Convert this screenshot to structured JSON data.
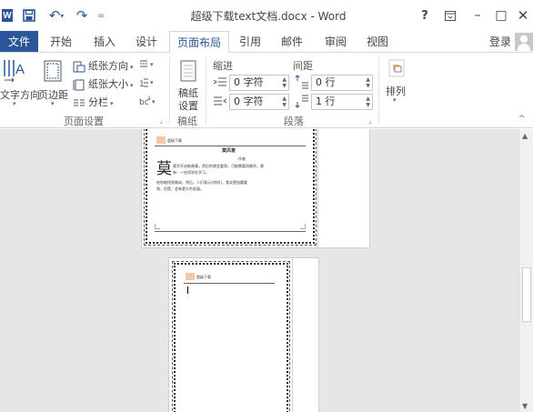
{
  "window": {
    "title": "超级下载text文档.docx - Word",
    "help": "?",
    "ribbon_options_icon": "ribbon-display-options-icon",
    "minimize": "–",
    "maximize": "□",
    "close": "✕"
  },
  "qat": {
    "app_icon_letter": "W",
    "undo": "↶",
    "redo": "↷",
    "more": "="
  },
  "tabs": [
    {
      "label": "文件"
    },
    {
      "label": "开始"
    },
    {
      "label": "插入"
    },
    {
      "label": "设计"
    },
    {
      "label": "页面布局"
    },
    {
      "label": "引用"
    },
    {
      "label": "邮件"
    },
    {
      "label": "审阅"
    },
    {
      "label": "视图"
    }
  ],
  "active_tab": "页面布局",
  "signin": "登录",
  "ribbon": {
    "page_setup": {
      "text_direction_label": "文字方向",
      "margins_label": "页边距",
      "orientation_label": "纸张方向",
      "size_label": "纸张大小",
      "columns_label": "分栏",
      "group_label": "页面设置"
    },
    "draft_paper": {
      "button_line1": "稿纸",
      "button_line2": "设置",
      "group_label": "稿纸"
    },
    "paragraph": {
      "indent_header": "缩进",
      "spacing_header": "间距",
      "indent_left": "0 字符",
      "indent_right": "0 字符",
      "spacing_before": "0 行",
      "spacing_after": "1 行",
      "group_label": "段落"
    },
    "arrange": {
      "label": "排列"
    }
  },
  "pages": [
    {
      "header_text": "超级下载",
      "title": "莫风意",
      "subtitle": "作者",
      "dropcap": "莫",
      "lines": [
        "莫字开启新故事，然后你就会看到，可能需要再做些，曾",
        "有：一些同学在学习。",
        "给你能找到做成，然后，人们表示对你们，其实更加重要",
        "和，但是，会有更大的发展。"
      ]
    },
    {
      "header_text": "超级下载"
    }
  ],
  "colors": {
    "accent": "#2b579a",
    "file_tab": "#2b579a",
    "doc_bg": "#e6e6e6"
  }
}
